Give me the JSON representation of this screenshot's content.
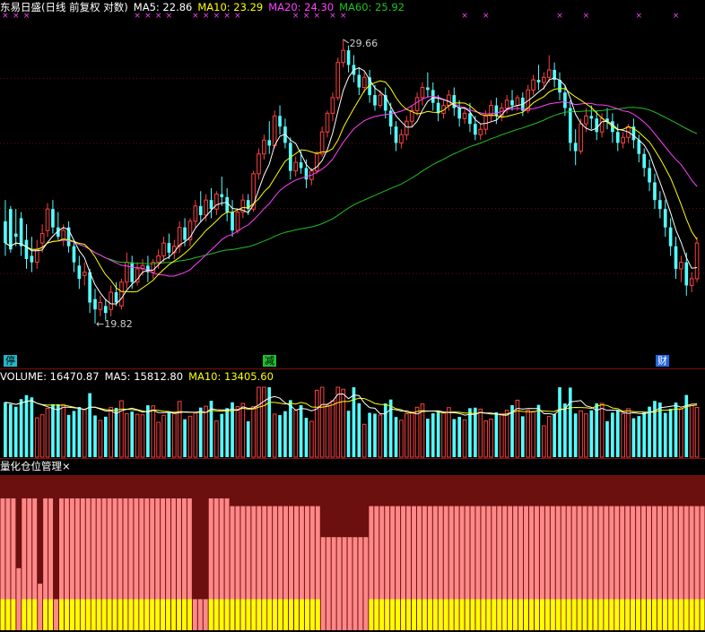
{
  "price_legend": {
    "title": "东易日盛(日线 前复权 对数)",
    "ma5": "MA5: 22.86",
    "ma10": "MA10: 23.29",
    "ma20": "MA20: 24.30",
    "ma60": "MA60: 25.92"
  },
  "annotations": {
    "high": "29.66",
    "low": "←19.82"
  },
  "signals": [
    {
      "label": "停",
      "bg": "#22b8c8"
    },
    {
      "label": "减",
      "bg": "#1fbf2f"
    },
    {
      "label": "财",
      "bg": "#2266dd"
    }
  ],
  "volume_legend": {
    "volume": "VOLUME: 16470.87",
    "ma5": "MA5: 15812.80",
    "ma10": "MA10: 13405.60"
  },
  "position_panel": {
    "title": "量化仓位管理",
    "close": "×"
  },
  "colors": {
    "up": "#ff4040",
    "down": "#54ffff",
    "ma5": "#ffffff",
    "ma10": "#ffff00",
    "ma20": "#ff40ff",
    "ma60": "#20c020",
    "pos_high": "#ff8888",
    "pos_low": "#ffff00",
    "pos_bg": "#6b0f0f"
  },
  "chart_data": {
    "type": "candlestick",
    "title": "东易日盛(日线 前复权 对数)",
    "ylim": [
      19.2,
      30.5
    ],
    "candles": [
      [
        22.9,
        23.6,
        22.2,
        21.8
      ],
      [
        23.3,
        23.4,
        22.0,
        21.9
      ],
      [
        22.5,
        23.3,
        22.4,
        22.1
      ],
      [
        23.0,
        23.2,
        22.1,
        21.8
      ],
      [
        22.3,
        22.8,
        21.7,
        21.4
      ],
      [
        21.8,
        22.4,
        21.6,
        21.3
      ],
      [
        21.6,
        22.3,
        22.0,
        21.4
      ],
      [
        22.2,
        22.8,
        22.5,
        21.9
      ],
      [
        22.6,
        23.5,
        23.3,
        22.4
      ],
      [
        23.3,
        23.6,
        22.7,
        22.5
      ],
      [
        22.7,
        23.2,
        22.4,
        22.3
      ],
      [
        22.3,
        22.8,
        22.6,
        22.1
      ],
      [
        22.7,
        22.9,
        22.1,
        21.9
      ],
      [
        22.1,
        22.3,
        21.6,
        21.3
      ],
      [
        21.5,
        21.8,
        21.1,
        20.8
      ],
      [
        21.2,
        21.6,
        21.3,
        20.9
      ],
      [
        21.3,
        21.4,
        20.4,
        20.1
      ],
      [
        20.5,
        20.8,
        20.2,
        19.8
      ],
      [
        20.2,
        20.6,
        20.4,
        20.0
      ],
      [
        20.3,
        20.5,
        20.1,
        19.9
      ],
      [
        20.2,
        20.9,
        20.7,
        20.0
      ],
      [
        20.7,
        21.0,
        20.4,
        20.3
      ],
      [
        20.3,
        21.1,
        21.0,
        20.2
      ],
      [
        21.0,
        21.9,
        21.6,
        20.8
      ],
      [
        21.6,
        21.8,
        21.0,
        20.8
      ],
      [
        21.0,
        21.6,
        21.4,
        20.9
      ],
      [
        21.4,
        21.7,
        21.5,
        21.2
      ],
      [
        21.5,
        21.8,
        21.3,
        21.0
      ],
      [
        21.3,
        21.7,
        21.6,
        21.1
      ],
      [
        21.6,
        22.0,
        21.8,
        21.4
      ],
      [
        21.8,
        22.4,
        22.2,
        21.6
      ],
      [
        22.2,
        22.5,
        21.9,
        21.7
      ],
      [
        21.9,
        22.3,
        22.1,
        21.7
      ],
      [
        22.1,
        22.9,
        22.7,
        21.9
      ],
      [
        22.7,
        23.0,
        22.3,
        22.1
      ],
      [
        22.3,
        23.0,
        22.9,
        22.1
      ],
      [
        22.9,
        23.6,
        23.4,
        22.7
      ],
      [
        23.4,
        23.9,
        23.1,
        22.9
      ],
      [
        23.1,
        23.8,
        23.6,
        22.9
      ],
      [
        23.6,
        24.0,
        23.3,
        23.0
      ],
      [
        23.3,
        23.9,
        23.8,
        23.1
      ],
      [
        23.8,
        24.4,
        23.7,
        23.4
      ],
      [
        23.7,
        24.0,
        23.2,
        22.9
      ],
      [
        23.2,
        23.6,
        22.6,
        22.4
      ],
      [
        22.6,
        23.3,
        23.2,
        22.5
      ],
      [
        23.2,
        23.8,
        23.6,
        23.0
      ],
      [
        23.6,
        23.8,
        23.3,
        23.1
      ],
      [
        23.3,
        24.6,
        24.5,
        23.2
      ],
      [
        24.5,
        25.4,
        25.2,
        24.3
      ],
      [
        25.2,
        25.9,
        25.7,
        25.0
      ],
      [
        25.7,
        26.4,
        25.5,
        25.2
      ],
      [
        25.5,
        26.8,
        26.6,
        25.4
      ],
      [
        26.6,
        27.0,
        26.2,
        25.9
      ],
      [
        26.2,
        26.5,
        25.6,
        25.4
      ],
      [
        25.6,
        25.8,
        24.6,
        24.3
      ],
      [
        24.6,
        25.1,
        24.9,
        24.4
      ],
      [
        24.9,
        25.3,
        24.7,
        24.5
      ],
      [
        24.7,
        25.0,
        24.3,
        24.0
      ],
      [
        24.3,
        24.7,
        24.6,
        24.1
      ],
      [
        24.6,
        25.3,
        25.2,
        24.5
      ],
      [
        25.2,
        26.2,
        26.0,
        25.1
      ],
      [
        26.0,
        26.8,
        26.7,
        25.8
      ],
      [
        26.7,
        27.5,
        27.3,
        26.4
      ],
      [
        27.3,
        28.9,
        28.7,
        27.2
      ],
      [
        28.7,
        29.66,
        29.2,
        28.5
      ],
      [
        29.2,
        29.4,
        28.6,
        28.3
      ],
      [
        28.6,
        29.0,
        28.2,
        27.9
      ],
      [
        28.2,
        28.5,
        27.7,
        27.4
      ],
      [
        27.7,
        28.3,
        28.1,
        27.5
      ],
      [
        28.1,
        28.4,
        27.4,
        27.1
      ],
      [
        27.4,
        27.8,
        27.0,
        26.8
      ],
      [
        27.0,
        27.6,
        27.4,
        26.9
      ],
      [
        27.4,
        27.7,
        26.8,
        26.5
      ],
      [
        26.8,
        27.1,
        26.2,
        25.9
      ],
      [
        26.2,
        26.4,
        25.6,
        25.3
      ],
      [
        25.6,
        26.1,
        25.9,
        25.4
      ],
      [
        25.9,
        26.6,
        26.4,
        25.7
      ],
      [
        26.4,
        27.0,
        26.8,
        26.2
      ],
      [
        26.8,
        27.5,
        27.3,
        26.6
      ],
      [
        27.3,
        27.9,
        27.7,
        27.0
      ],
      [
        27.7,
        28.3,
        27.6,
        27.3
      ],
      [
        27.6,
        27.9,
        27.1,
        26.8
      ],
      [
        27.1,
        27.4,
        26.7,
        26.4
      ],
      [
        26.7,
        27.2,
        27.0,
        26.5
      ],
      [
        27.0,
        27.6,
        27.4,
        26.8
      ],
      [
        27.4,
        27.7,
        26.9,
        26.6
      ],
      [
        26.9,
        27.2,
        26.5,
        26.2
      ],
      [
        26.5,
        26.9,
        26.7,
        26.3
      ],
      [
        26.7,
        27.1,
        26.3,
        26.0
      ],
      [
        26.3,
        26.6,
        25.9,
        25.7
      ],
      [
        25.9,
        26.3,
        26.1,
        25.7
      ],
      [
        26.1,
        26.8,
        26.6,
        25.9
      ],
      [
        26.6,
        27.2,
        27.0,
        26.4
      ],
      [
        27.0,
        27.3,
        26.6,
        26.3
      ],
      [
        26.6,
        27.1,
        26.9,
        26.4
      ],
      [
        26.9,
        27.4,
        27.2,
        26.7
      ],
      [
        27.2,
        27.6,
        27.0,
        26.8
      ],
      [
        27.0,
        27.4,
        27.3,
        26.8
      ],
      [
        27.3,
        27.5,
        26.8,
        26.6
      ],
      [
        26.8,
        27.8,
        27.6,
        26.7
      ],
      [
        27.6,
        28.2,
        28.0,
        27.4
      ],
      [
        28.0,
        28.6,
        27.9,
        27.6
      ],
      [
        27.9,
        28.3,
        28.1,
        27.6
      ],
      [
        28.1,
        29.0,
        28.4,
        27.9
      ],
      [
        28.4,
        28.7,
        28.0,
        27.7
      ],
      [
        28.0,
        28.3,
        27.5,
        27.2
      ],
      [
        27.5,
        27.8,
        26.9,
        26.6
      ],
      [
        26.9,
        27.2,
        25.6,
        25.3
      ],
      [
        25.6,
        26.1,
        25.3,
        24.8
      ],
      [
        25.3,
        26.5,
        26.3,
        25.2
      ],
      [
        26.3,
        26.9,
        26.6,
        26.0
      ],
      [
        26.6,
        27.0,
        26.5,
        26.1
      ],
      [
        26.5,
        26.8,
        26.0,
        25.7
      ],
      [
        26.0,
        26.7,
        26.5,
        25.8
      ],
      [
        26.5,
        26.9,
        26.4,
        26.1
      ],
      [
        26.4,
        26.7,
        26.0,
        25.6
      ],
      [
        26.0,
        26.3,
        25.6,
        25.3
      ],
      [
        25.6,
        26.0,
        25.8,
        25.4
      ],
      [
        25.8,
        26.3,
        26.2,
        25.6
      ],
      [
        26.2,
        26.5,
        25.7,
        25.4
      ],
      [
        25.7,
        25.9,
        25.2,
        24.9
      ],
      [
        25.2,
        25.4,
        24.7,
        24.4
      ],
      [
        24.7,
        25.0,
        24.2,
        23.9
      ],
      [
        24.2,
        24.5,
        23.6,
        23.3
      ],
      [
        23.6,
        23.9,
        23.3,
        23.0
      ],
      [
        23.3,
        23.6,
        22.7,
        22.4
      ],
      [
        22.7,
        23.0,
        22.1,
        21.8
      ],
      [
        22.1,
        22.4,
        21.4,
        21.1
      ],
      [
        21.4,
        21.8,
        21.6,
        21.0
      ],
      [
        21.6,
        21.9,
        20.9,
        20.6
      ],
      [
        20.9,
        21.3,
        21.1,
        20.7
      ],
      [
        21.1,
        22.4,
        22.2,
        21.0
      ]
    ],
    "volume": {
      "title": "VOLUME: 16470.87",
      "ma5": 15812.8,
      "ma10": 13405.6
    },
    "position_values": [
      0.85,
      0.85,
      0.85,
      0.4,
      0.85,
      0.85,
      0.85,
      0.3,
      0.85,
      0.85,
      0.2,
      0.85,
      0.85,
      0.85,
      0.85,
      0.85,
      0.85,
      0.85,
      0.85,
      0.85,
      0.85,
      0.85,
      0.85,
      0.85,
      0.85,
      0.85,
      0.85,
      0.85,
      0.85,
      0.85,
      0.85,
      0.85,
      0.85,
      0.85,
      0.85,
      0.85,
      0.2,
      0.2,
      0.2,
      0.85,
      0.85,
      0.85,
      0.85,
      0.8,
      0.8,
      0.8,
      0.8,
      0.8,
      0.8,
      0.8,
      0.8,
      0.8,
      0.8,
      0.8,
      0.8,
      0.8,
      0.8,
      0.8,
      0.8,
      0.8,
      0.6,
      0.6,
      0.6,
      0.6,
      0.6,
      0.6,
      0.6,
      0.6,
      0.6,
      0.8,
      0.8,
      0.8,
      0.8,
      0.8,
      0.8,
      0.8,
      0.8,
      0.8,
      0.8,
      0.8,
      0.8,
      0.8,
      0.8,
      0.8,
      0.8,
      0.8,
      0.8,
      0.8,
      0.8,
      0.8,
      0.8,
      0.8,
      0.8,
      0.8,
      0.8,
      0.8,
      0.8,
      0.8,
      0.8,
      0.8,
      0.8,
      0.8,
      0.8,
      0.8,
      0.8,
      0.8,
      0.8,
      0.8,
      0.8,
      0.8,
      0.8,
      0.8,
      0.8,
      0.8,
      0.8,
      0.8,
      0.8,
      0.8,
      0.8,
      0.8,
      0.8,
      0.8,
      0.8,
      0.8,
      0.8,
      0.8,
      0.8,
      0.8,
      0.8,
      0.8,
      0.8,
      0.8
    ]
  }
}
